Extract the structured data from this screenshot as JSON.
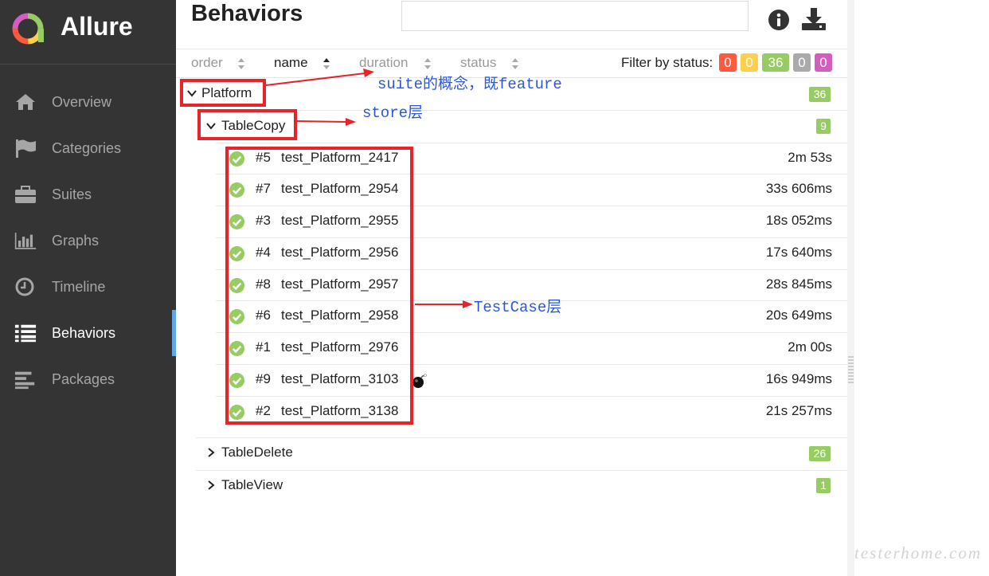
{
  "app": {
    "name": "Allure"
  },
  "sidebar": {
    "items": [
      {
        "label": "Overview",
        "icon": "home-icon"
      },
      {
        "label": "Categories",
        "icon": "flag-icon"
      },
      {
        "label": "Suites",
        "icon": "briefcase-icon"
      },
      {
        "label": "Graphs",
        "icon": "bar-chart-icon"
      },
      {
        "label": "Timeline",
        "icon": "clock-icon"
      },
      {
        "label": "Behaviors",
        "icon": "list-icon",
        "active": true
      },
      {
        "label": "Packages",
        "icon": "align-left-icon"
      }
    ]
  },
  "header": {
    "title": "Behaviors",
    "search_placeholder": ""
  },
  "sort": {
    "columns": [
      "order",
      "name",
      "duration",
      "status"
    ],
    "active": "name",
    "filter_label": "Filter by status:",
    "status_counts": [
      {
        "status": "failed",
        "value": "0",
        "color": "#fd5a3e"
      },
      {
        "status": "broken",
        "value": "0",
        "color": "#ffd050"
      },
      {
        "status": "passed",
        "value": "36",
        "color": "#97cc64"
      },
      {
        "status": "skipped",
        "value": "0",
        "color": "#aaaaaa"
      },
      {
        "status": "unknown",
        "value": "0",
        "color": "#d35ebe"
      }
    ]
  },
  "tree": {
    "epic": {
      "label": "Platform",
      "count": "36",
      "expanded": true
    },
    "feature": {
      "label": "TableCopy",
      "count": "9",
      "expanded": true
    },
    "tests": [
      {
        "num": "#5",
        "name": "test_Platform_2417",
        "duration": "2m 53s"
      },
      {
        "num": "#7",
        "name": "test_Platform_2954",
        "duration": "33s 606ms"
      },
      {
        "num": "#3",
        "name": "test_Platform_2955",
        "duration": "18s 052ms"
      },
      {
        "num": "#4",
        "name": "test_Platform_2956",
        "duration": "17s 640ms"
      },
      {
        "num": "#8",
        "name": "test_Platform_2957",
        "duration": "28s 845ms"
      },
      {
        "num": "#6",
        "name": "test_Platform_2958",
        "duration": "20s 649ms"
      },
      {
        "num": "#1",
        "name": "test_Platform_2976",
        "duration": "2m 00s"
      },
      {
        "num": "#9",
        "name": "test_Platform_3103",
        "duration": "16s 949ms",
        "flaky_icon": "bomb-icon"
      },
      {
        "num": "#2",
        "name": "test_Platform_3138",
        "duration": "21s 257ms"
      }
    ],
    "collapsed": [
      {
        "label": "TableDelete",
        "count": "26"
      },
      {
        "label": "TableView",
        "count": "1"
      }
    ]
  },
  "annotations": {
    "suite": "suite的概念，既feature",
    "store": "store层",
    "testcase": "TestCase层",
    "color": "#e8232a"
  },
  "watermark": "testerhome.com"
}
